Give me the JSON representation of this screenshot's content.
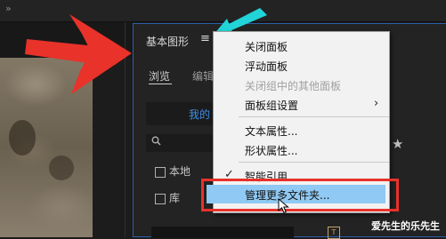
{
  "panel": {
    "title": "基本图形",
    "menu_icon": "≡",
    "tabs": {
      "browse": "浏览",
      "edit": "编辑"
    },
    "my_templates": "我的",
    "search_icon": "magnifier-icon",
    "star_icon": "★",
    "checkboxes": {
      "local": "本地",
      "library": "库"
    },
    "type_tool_glyph": "T"
  },
  "context_menu": {
    "items": [
      {
        "label": "关闭面板",
        "enabled": true
      },
      {
        "label": "浮动面板",
        "enabled": true
      },
      {
        "label": "关闭组中的其他面板",
        "enabled": false
      },
      {
        "label": "面板组设置",
        "enabled": true,
        "submenu": true,
        "arrow": "›"
      },
      {
        "label": "文本属性...",
        "enabled": true
      },
      {
        "label": "形状属性...",
        "enabled": true
      },
      {
        "label": "智能引用",
        "enabled": true,
        "checked": true,
        "check": "✓"
      },
      {
        "label": "管理更多文件夹...",
        "enabled": true,
        "highlighted": true
      }
    ]
  },
  "topbar": {
    "glyph": "»"
  },
  "watermark": "爱先生的乐先生",
  "colors": {
    "highlight": "#90c9f3",
    "panel_border": "#2d5fa8",
    "annotation_red": "#e8322a",
    "annotation_cyan": "#22d4d8",
    "link_blue": "#3d8ee8"
  }
}
